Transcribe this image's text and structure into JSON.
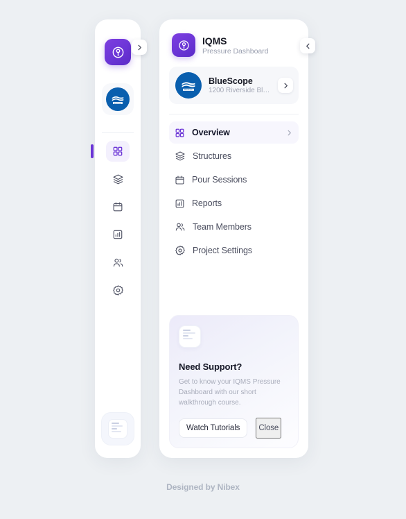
{
  "brand": {
    "title": "IQMS",
    "subtitle": "Pressure Dashboard",
    "logo_icon": "iqms-gauge-icon",
    "accent_color": "#6b35d6"
  },
  "organization": {
    "name": "BlueScope",
    "address": "1200 Riverside Blvd,...",
    "logo_icon": "bluescope-logo-icon",
    "logo_color": "#0a5fae",
    "chevron_icon": "chevron-right-icon"
  },
  "rail": {
    "collapse_icon": "chevron-right-icon",
    "items": [
      {
        "name": "overview",
        "icon": "grid-icon",
        "active": true
      },
      {
        "name": "structures",
        "icon": "layers-icon",
        "active": false
      },
      {
        "name": "pour-sessions",
        "icon": "calendar-icon",
        "active": false
      },
      {
        "name": "reports",
        "icon": "bar-chart-icon",
        "active": false
      },
      {
        "name": "team-members",
        "icon": "users-icon",
        "active": false
      },
      {
        "name": "project-settings",
        "icon": "gear-icon",
        "active": false
      }
    ],
    "bottom_icon": "tutorial-card-icon"
  },
  "panel": {
    "collapse_icon": "chevron-left-icon"
  },
  "nav": {
    "items": [
      {
        "label": "Overview",
        "icon": "grid-icon",
        "active": true,
        "arrow_icon": "chevron-right-icon"
      },
      {
        "label": "Structures",
        "icon": "layers-icon",
        "active": false
      },
      {
        "label": "Pour Sessions",
        "icon": "calendar-icon",
        "active": false
      },
      {
        "label": "Reports",
        "icon": "bar-chart-icon",
        "active": false
      },
      {
        "label": "Team Members",
        "icon": "users-icon",
        "active": false
      },
      {
        "label": "Project Settings",
        "icon": "gear-icon",
        "active": false
      }
    ]
  },
  "support": {
    "illustration_icon": "tutorial-card-icon",
    "title": "Need Support?",
    "body": "Get to know your IQMS Pressure Dashboard with our short walkthrough course.",
    "primary_label": "Watch Tutorials",
    "secondary_label": "Close"
  },
  "footer": {
    "text": "Designed by Nibex"
  }
}
